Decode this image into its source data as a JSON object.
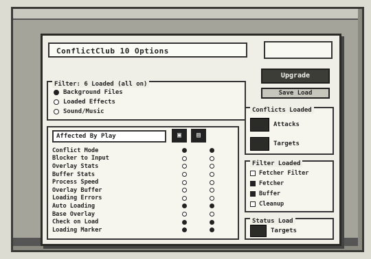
{
  "dialog": {
    "title": "ConflictClub 10 Options",
    "buttons": {
      "upgrade": "Upgrade",
      "small": "Save  Load"
    }
  },
  "filters": {
    "label": "Filter: 6 Loaded (all on)",
    "options": [
      {
        "label": "Background Files",
        "selected": true
      },
      {
        "label": "Loaded Effects",
        "selected": false
      },
      {
        "label": "Sound/Music",
        "selected": false
      }
    ]
  },
  "list": {
    "header": "Affected By Play",
    "rows": [
      {
        "label": "Conflict Mode",
        "c1": true,
        "c2": true
      },
      {
        "label": "Blocker to Input",
        "c1": false,
        "c2": false
      },
      {
        "label": "Overlay Stats",
        "c1": false,
        "c2": false
      },
      {
        "label": "Buffer Stats",
        "c1": false,
        "c2": false
      },
      {
        "label": "Process Speed",
        "c1": false,
        "c2": false
      },
      {
        "label": "Overlay Buffer",
        "c1": false,
        "c2": false
      },
      {
        "label": "Loading Errors",
        "c1": false,
        "c2": false
      },
      {
        "label": "Auto Loading",
        "c1": true,
        "c2": true
      },
      {
        "label": "Base Overlay",
        "c1": false,
        "c2": false
      },
      {
        "label": "Check on Load",
        "c1": true,
        "c2": true
      },
      {
        "label": "Loading Marker",
        "c1": true,
        "c2": true
      }
    ]
  },
  "conflicts": {
    "label": "Conflicts Loaded",
    "items": [
      {
        "label": "Attacks"
      },
      {
        "label": "Targets"
      }
    ]
  },
  "filter2": {
    "label": "Filter Loaded",
    "options": [
      {
        "label": "Fetcher Filter",
        "checked": false
      },
      {
        "label": "Fetcher",
        "checked": true
      },
      {
        "label": "Buffer",
        "checked": true
      },
      {
        "label": "Cleanup",
        "checked": false
      }
    ]
  },
  "bottom": {
    "label": "Status Load",
    "item": {
      "label": "Targets"
    }
  }
}
